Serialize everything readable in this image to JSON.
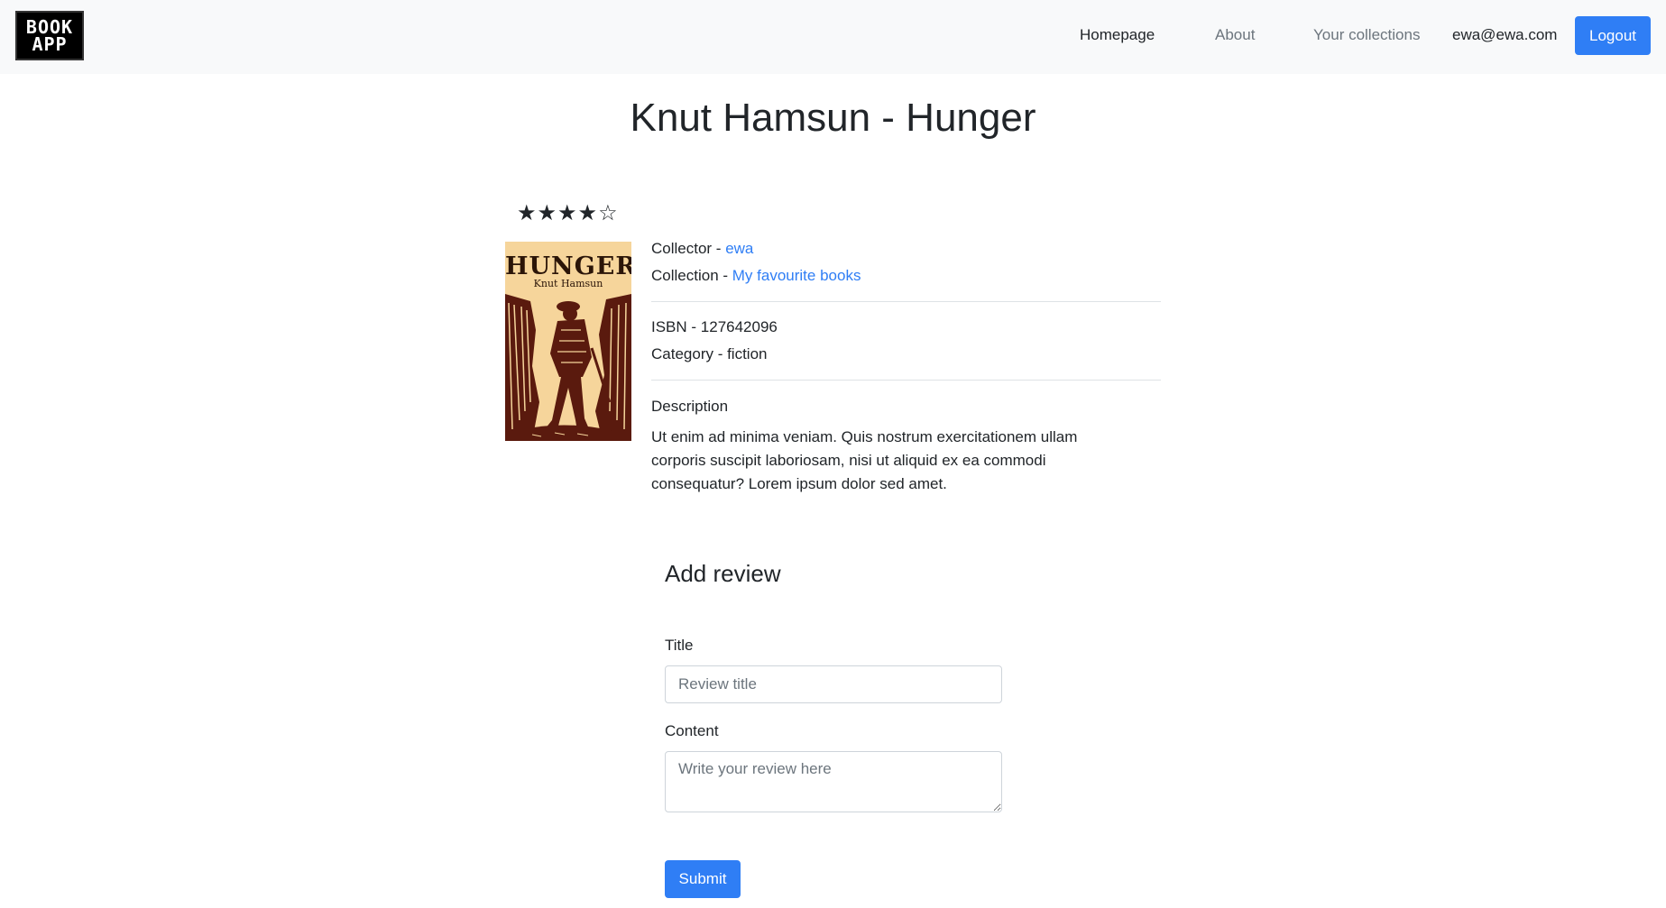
{
  "navbar": {
    "logo": {
      "line1": "BOOK",
      "line2": "APP"
    },
    "links": {
      "homepage": "Homepage",
      "about": "About",
      "collections": "Your collections"
    },
    "user_email": "ewa@ewa.com",
    "logout_label": "Logout"
  },
  "book": {
    "title": "Knut Hamsun - Hunger",
    "rating": {
      "value": 4,
      "max": 5,
      "display": "★★★★☆"
    },
    "cover": {
      "title": "HUNGER",
      "author": "Knut Hamsun"
    },
    "collector_label": "Collector - ",
    "collector_name": "ewa",
    "collection_label": "Collection - ",
    "collection_name": "My favourite books",
    "isbn": "ISBN - 127642096",
    "category": "Category - fiction",
    "description_label": "Description",
    "description": "Ut enim ad minima veniam. Quis nostrum exercitationem ullam corporis suscipit laboriosam, nisi ut aliquid ex ea commodi consequatur? Lorem ipsum dolor sed amet."
  },
  "review_form": {
    "heading": "Add review",
    "title_label": "Title",
    "title_placeholder": "Review title",
    "content_label": "Content",
    "content_placeholder": "Write your review here",
    "submit_label": "Submit"
  },
  "colors": {
    "primary": "#2f7ef5",
    "navbar_bg": "#f8f9fa",
    "cover_bg": "#f6d59b",
    "cover_ink": "#5a1a0e"
  }
}
